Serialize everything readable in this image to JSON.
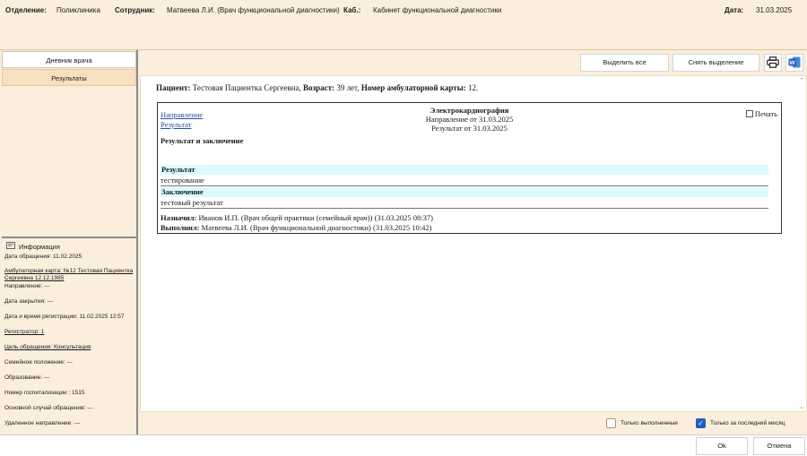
{
  "header": {
    "department_label": "Отделение:",
    "department_value": "Поликлиника",
    "employee_label": "Сотрудник:",
    "employee_value": "Матвеева Л.И. (Врач функциональной диагностики)",
    "cabinet_label": "Каб.:",
    "cabinet_value": "Кабинет функциональной диагностики",
    "date_label": "Дата:",
    "date_value": "31.03.2025"
  },
  "left": {
    "tabs": [
      {
        "label": "Дневник врача"
      },
      {
        "label": "Результаты"
      }
    ],
    "info_title": "Информация",
    "info_lines": [
      "Дата обращения: 11.02.2025",
      "Амбулаторная карта: №12 Тестовая Пациентка Сергеевна 12.12.1985",
      "Направление: ---",
      "Дата закрытия: ---",
      "Дата и время регистрации: 11.02.2025 12:57",
      "Регистратор: 1",
      "Цель обращения: Консультация",
      "Семейное положение: ---",
      "Образование: ---",
      "Номер госпитализации : 1515",
      "Основной случай обращения: ---",
      "Удаленное направление: ---"
    ]
  },
  "toolbar": {
    "select_all": "Выделить все",
    "deselect": "Снять выделение",
    "print_icon": "printer-icon",
    "word_icon": "word-icon"
  },
  "document": {
    "patient_label": "Пациент:",
    "patient_value": "Тестовая Пациентка Сергеевна,",
    "age_label": "Возраст:",
    "age_value": "39 лет,",
    "card_label": "Номер амбулаторной карты:",
    "card_value": "12.",
    "link_direction": "Направление",
    "link_result": "Результат",
    "exam_title": "Электрокардиография",
    "direction_date": "Направление от 31.03.2025",
    "result_date": "Результат от 31.03.2025",
    "print_label": "Печать",
    "section_title": "Результат и заключение",
    "result_label": "Результат",
    "result_text": "тестирование",
    "conclusion_label": "Заключение",
    "conclusion_text": "тестовый результат",
    "assigned_label": "Назначил:",
    "assigned_value": "Иванов И.П. (Врач общей практики (семейный врач)) (31.03.2025 08:37)",
    "performed_label": "Выполнил:",
    "performed_value": "Матвеева Л.И. (Врач функциональной диагностики) (31.03.2025 10:42)"
  },
  "filters": {
    "only_done": "Только выполненные",
    "only_done_checked": false,
    "last_month": "Только за последний месяц",
    "last_month_checked": true
  },
  "footer": {
    "ok": "Ok",
    "cancel": "Отмена"
  },
  "colors": {
    "background": "#fbeedd",
    "active_tab": "#f7dfc0",
    "band": "#dcfafd",
    "checkbox_accent": "#1f5fbf"
  }
}
